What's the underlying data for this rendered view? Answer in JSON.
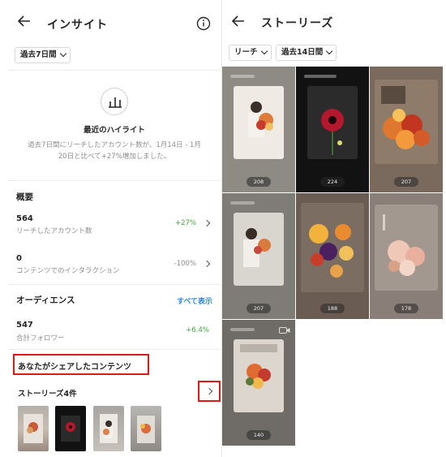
{
  "left_screen": {
    "title": "インサイト",
    "period_filter": "過去7日間",
    "highlight": {
      "title": "最近のハイライト",
      "description": "過去7日間にリーチしたアカウント数が、1月14日 - 1月20日と比べて+27%増加しました。"
    },
    "overview": {
      "title": "概要",
      "metrics": [
        {
          "value": "564",
          "label": "リーチしたアカウント数",
          "change": "+27%"
        },
        {
          "value": "0",
          "label": "コンテンツでのインタラクション",
          "change": "-100%"
        }
      ]
    },
    "audience": {
      "title": "オーディエンス",
      "see_all": "すべて表示",
      "value": "547",
      "label": "合計フォロワー",
      "change": "+6.4%"
    },
    "shared_content": {
      "title": "あなたがシェアしたコンテンツ",
      "stories_label": "ストーリーズ4件"
    }
  },
  "right_screen": {
    "title": "ストーリーズ",
    "metric_filter": "リーチ",
    "period_filter": "過去14日間",
    "stories": [
      {
        "views": "208"
      },
      {
        "views": "224"
      },
      {
        "views": "207"
      },
      {
        "views": "207"
      },
      {
        "views": "188"
      },
      {
        "views": "178"
      },
      {
        "views": "140"
      }
    ]
  },
  "colors": {
    "positive": "#3aaa3a",
    "link": "#2e8ae6",
    "highlight_box": "#e01818"
  },
  "icons": [
    "back-arrow-icon",
    "info-icon",
    "chart-icon",
    "chevron-right-icon",
    "chevron-down-icon",
    "camera-icon"
  ]
}
